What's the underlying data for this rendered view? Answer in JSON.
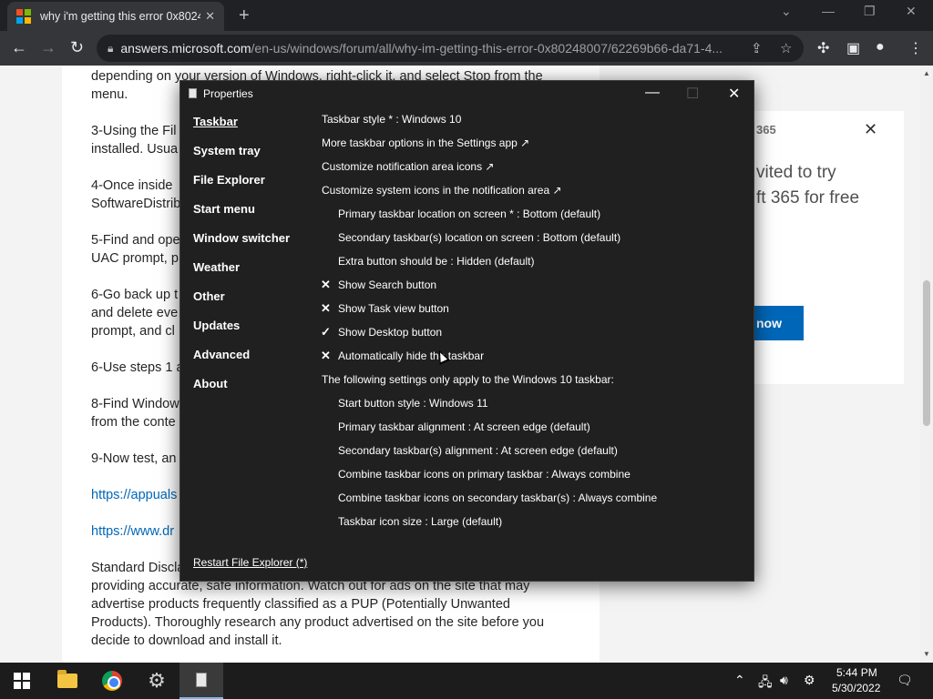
{
  "browser": {
    "tab_title": "why i'm getting this error 0x8024",
    "tab_close": "✕",
    "new_tab": "+",
    "url_domain": "answers.microsoft.com",
    "url_path": "/en-us/windows/forum/all/why-im-getting-this-error-0x80248007/62269b66-da71-4...",
    "window_controls": {
      "dropdown": "⌄",
      "minimize": "—",
      "restore": "❐",
      "close": "✕"
    }
  },
  "article": {
    "lines": [
      "depending on your version of Windows, right-click it, and select Stop from the",
      "menu.",
      "",
      "3-Using the Fil",
      "installed. Usua",
      "",
      "4-Once inside",
      "SoftwareDistrib",
      "",
      "5-Find and ope",
      "UAC prompt, p",
      "",
      "6-Go back up t",
      "and delete eve",
      "prompt, and cl",
      "",
      "6-Use steps 1 a",
      "",
      "8-Find Window",
      "from the conte",
      "",
      "9-Now test, an"
    ],
    "links": [
      "https://appuals",
      "https://www.dr"
    ],
    "disclaimer_lines": [
      "Standard Discla",
      "providing accurate, safe information. Watch out for ads on the site that may",
      "advertise products frequently classified as a PUP (Potentially Unwanted",
      "Products). Thoroughly research any product advertised on the site before you",
      "decide to download and install it."
    ]
  },
  "promo": {
    "brand": "365",
    "line1": "vited to try",
    "line2": "ft 365 for free",
    "button": "now",
    "close": "✕"
  },
  "dialog": {
    "title": "Properties",
    "controls": {
      "minimize": "—",
      "maximize": "☐",
      "close": "✕"
    },
    "nav": [
      "Taskbar",
      "System tray",
      "File Explorer",
      "Start menu",
      "Window switcher",
      "Weather",
      "Other",
      "Updates",
      "Advanced",
      "About"
    ],
    "restart": "Restart File Explorer (*)",
    "options": [
      {
        "text": "Taskbar style * : Windows 10",
        "indent": false,
        "mark": ""
      },
      {
        "text": "More taskbar options in the Settings app ↗",
        "indent": false,
        "mark": ""
      },
      {
        "text": "Customize notification area icons ↗",
        "indent": false,
        "mark": ""
      },
      {
        "text": "Customize system icons in the notification area ↗",
        "indent": false,
        "mark": ""
      },
      {
        "text": "Primary taskbar location on screen * : Bottom (default)",
        "indent": true,
        "mark": ""
      },
      {
        "text": "Secondary taskbar(s) location on screen : Bottom (default)",
        "indent": true,
        "mark": ""
      },
      {
        "text": "Extra button should be : Hidden (default)",
        "indent": true,
        "mark": ""
      },
      {
        "text": "Show Search button",
        "indent": true,
        "mark": "✕"
      },
      {
        "text": "Show Task view button",
        "indent": true,
        "mark": "✕"
      },
      {
        "text": "Show Desktop button",
        "indent": true,
        "mark": "✓"
      },
      {
        "text": "Automatically hide the taskbar",
        "indent": true,
        "mark": "✕"
      },
      {
        "text": "The following settings only apply to the Windows 10 taskbar:",
        "indent": false,
        "mark": ""
      },
      {
        "text": "Start button style : Windows 11",
        "indent": true,
        "mark": ""
      },
      {
        "text": "Primary taskbar alignment : At screen edge (default)",
        "indent": true,
        "mark": ""
      },
      {
        "text": "Secondary taskbar(s) alignment : At screen edge (default)",
        "indent": true,
        "mark": ""
      },
      {
        "text": "Combine taskbar icons on primary taskbar : Always combine",
        "indent": true,
        "mark": ""
      },
      {
        "text": "Combine taskbar icons on secondary taskbar(s) : Always combine",
        "indent": true,
        "mark": ""
      },
      {
        "text": "Taskbar icon size : Large (default)",
        "indent": true,
        "mark": ""
      }
    ]
  },
  "taskbar": {
    "time": "5:44 PM",
    "date": "5/30/2022",
    "tray_icons": [
      "chevron-up-icon",
      "network-icon",
      "volume-icon",
      "settings-icon",
      "notification-icon"
    ]
  }
}
